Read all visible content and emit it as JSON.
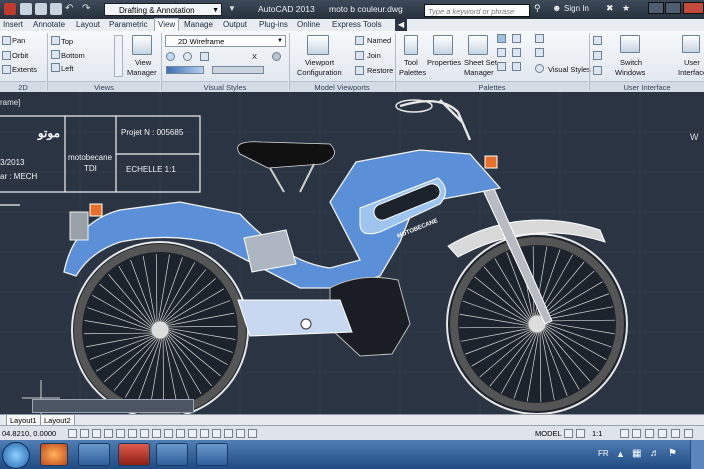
{
  "titlebar": {
    "workspace": "Drafting & Annotation",
    "app_title": "AutoCAD 2013",
    "file_title": "moto b couleur.dwg",
    "search_placeholder": "Type a keyword or phrase",
    "sign_in": "Sign In"
  },
  "ribbon_tabs": [
    "Insert",
    "Annotate",
    "Layout",
    "Parametric",
    "View",
    "Manage",
    "Output",
    "Plug-ins",
    "Online",
    "Express Tools"
  ],
  "active_tab": "View",
  "ribbon": {
    "navigate": {
      "pan": "Pan",
      "orbit": "Orbit",
      "extents": "Extents",
      "title": "2D"
    },
    "views": {
      "top": "Top",
      "bottom": "Bottom",
      "left": "Left",
      "view_manager_1": "View",
      "view_manager_2": "Manager",
      "title": "Views"
    },
    "visual_styles": {
      "dropdown": "2D Wireframe",
      "title": "Visual Styles",
      "x_label": "X"
    },
    "model_viewports": {
      "viewport_config_1": "Viewport",
      "viewport_config_2": "Configuration",
      "named": "Named",
      "join": "Join",
      "restore": "Restore",
      "title": "Model Viewports"
    },
    "palettes": {
      "tool_palettes_1": "Tool",
      "tool_palettes_2": "Palettes",
      "properties": "Properties",
      "sheet_set_1": "Sheet Set",
      "sheet_set_2": "Manager",
      "visual_styles": "Visual Styles",
      "title": "Palettes"
    },
    "user_interface": {
      "switch_windows_1": "Switch",
      "switch_windows_2": "Windows",
      "user_interface_1": "User",
      "user_interface_2": "Interface",
      "title": "User Interface"
    }
  },
  "canvas": {
    "viewport_label": "rame]",
    "titleblock": {
      "arabic_title": "موتو",
      "date": "3/2013",
      "author": "ar : MECH",
      "name_1": "motobecane",
      "name_2": "TDI",
      "project": "Projet N : 005685",
      "scale": "ECHELLE 1:1"
    },
    "tank_brand": "MOTOBECANE",
    "viewcube_letter": "W"
  },
  "layout_tabs": [
    "Layout1",
    "Layout2"
  ],
  "statusbar": {
    "coords": "04.8210, 0.0000",
    "model": "MODEL",
    "scale": "1:1"
  },
  "taskbar": {
    "lang": "FR"
  },
  "colors": {
    "canvas": "#2b3442",
    "bike_blue": "#5b90d8",
    "bike_blue_light": "#9fc4ee",
    "orange": "#e8702a",
    "taskbar": "#2f5f9b"
  }
}
